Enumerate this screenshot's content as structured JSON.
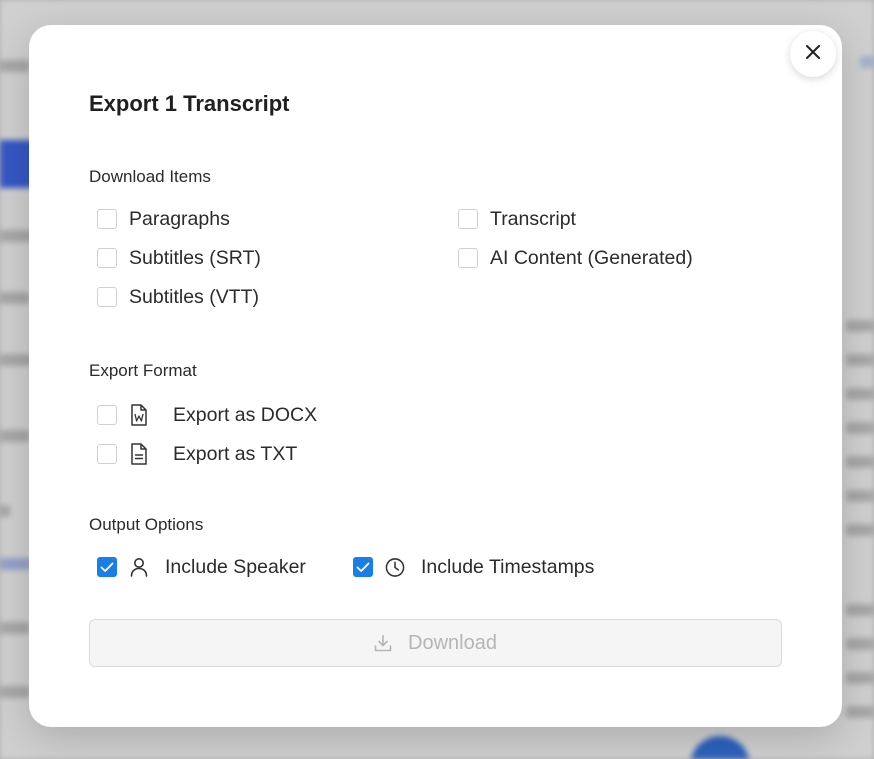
{
  "modal": {
    "title": "Export 1 Transcript"
  },
  "download_items": {
    "label": "Download Items",
    "options": [
      {
        "label": "Paragraphs",
        "checked": false
      },
      {
        "label": "Transcript",
        "checked": false
      },
      {
        "label": "Subtitles (SRT)",
        "checked": false
      },
      {
        "label": "AI Content (Generated)",
        "checked": false
      },
      {
        "label": "Subtitles (VTT)",
        "checked": false
      }
    ]
  },
  "export_format": {
    "label": "Export Format",
    "options": [
      {
        "label": "Export as DOCX",
        "icon": "docx-file-icon",
        "checked": false
      },
      {
        "label": "Export as TXT",
        "icon": "txt-file-icon",
        "checked": false
      }
    ]
  },
  "output_options": {
    "label": "Output Options",
    "options": [
      {
        "label": "Include Speaker",
        "icon": "person-icon",
        "checked": true
      },
      {
        "label": "Include Timestamps",
        "icon": "clock-icon",
        "checked": true
      }
    ]
  },
  "download_button": {
    "label": "Download",
    "disabled": true
  },
  "colors": {
    "accent": "#1a7fe4",
    "disabled_text": "#b5b5b5"
  }
}
